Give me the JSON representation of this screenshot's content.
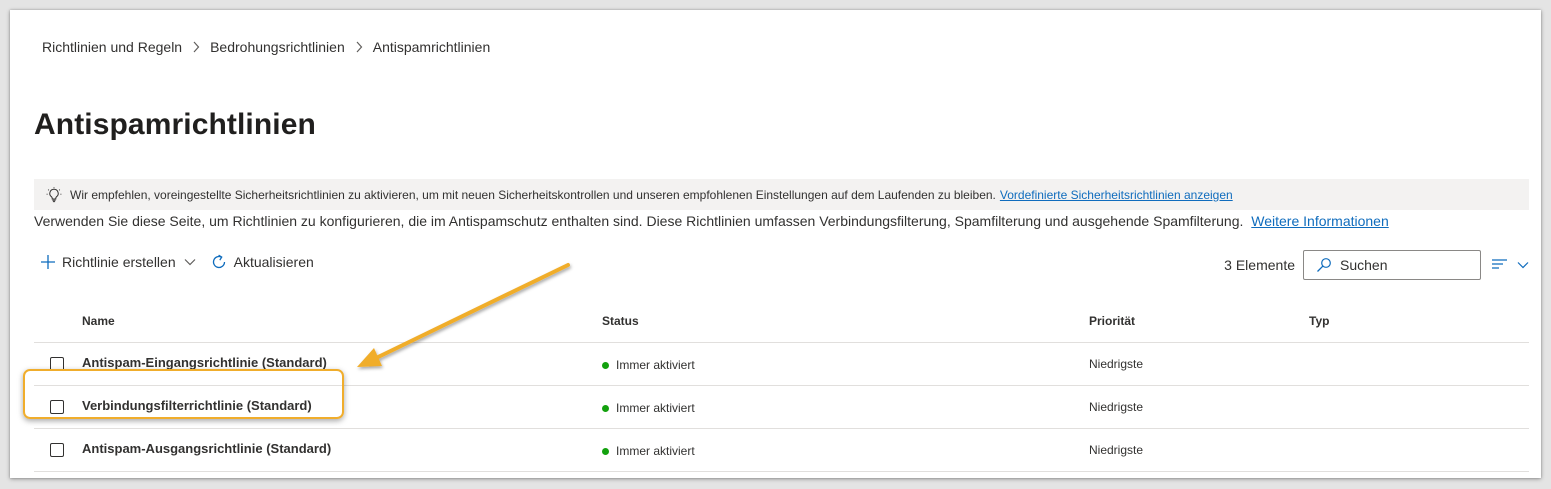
{
  "breadcrumb": [
    "Richtlinien und Regeln",
    "Bedrohungsrichtlinien",
    "Antispamrichtlinien"
  ],
  "page_title": "Antispamrichtlinien",
  "banner": {
    "text": "Wir empfehlen, voreingestellte Sicherheitsrichtlinien zu aktivieren, um mit neuen Sicherheitskontrollen und unseren empfohlenen Einstellungen auf dem Laufenden zu bleiben.",
    "link": "Vordefinierte Sicherheitsrichtlinien anzeigen",
    "icon": "lightbulb-icon"
  },
  "description": {
    "text": "Verwenden Sie diese Seite, um Richtlinien zu konfigurieren, die im Antispamschutz enthalten sind. Diese Richtlinien umfassen Verbindungsfilterung, Spamfilterung und ausgehende Spamfilterung.",
    "link": "Weitere Informationen"
  },
  "toolbar": {
    "create_label": "Richtlinie erstellen",
    "refresh_label": "Aktualisieren",
    "count_label": "3 Elemente",
    "search_placeholder": "Suchen"
  },
  "table": {
    "columns": {
      "name": "Name",
      "status": "Status",
      "priority": "Priorität",
      "type": "Typ"
    },
    "rows": [
      {
        "name": "Antispam-Eingangsrichtlinie (Standard)",
        "status": "Immer aktiviert",
        "priority": "Niedrigste",
        "type": ""
      },
      {
        "name": "Verbindungsfilterrichtlinie (Standard)",
        "status": "Immer aktiviert",
        "priority": "Niedrigste",
        "type": ""
      },
      {
        "name": "Antispam-Ausgangsrichtlinie (Standard)",
        "status": "Immer aktiviert",
        "priority": "Niedrigste",
        "type": ""
      }
    ]
  },
  "colors": {
    "link": "#0f6cbd",
    "status_active": "#13a10e",
    "highlight": "#f0ad2c",
    "accent": "#0f6cbd"
  }
}
